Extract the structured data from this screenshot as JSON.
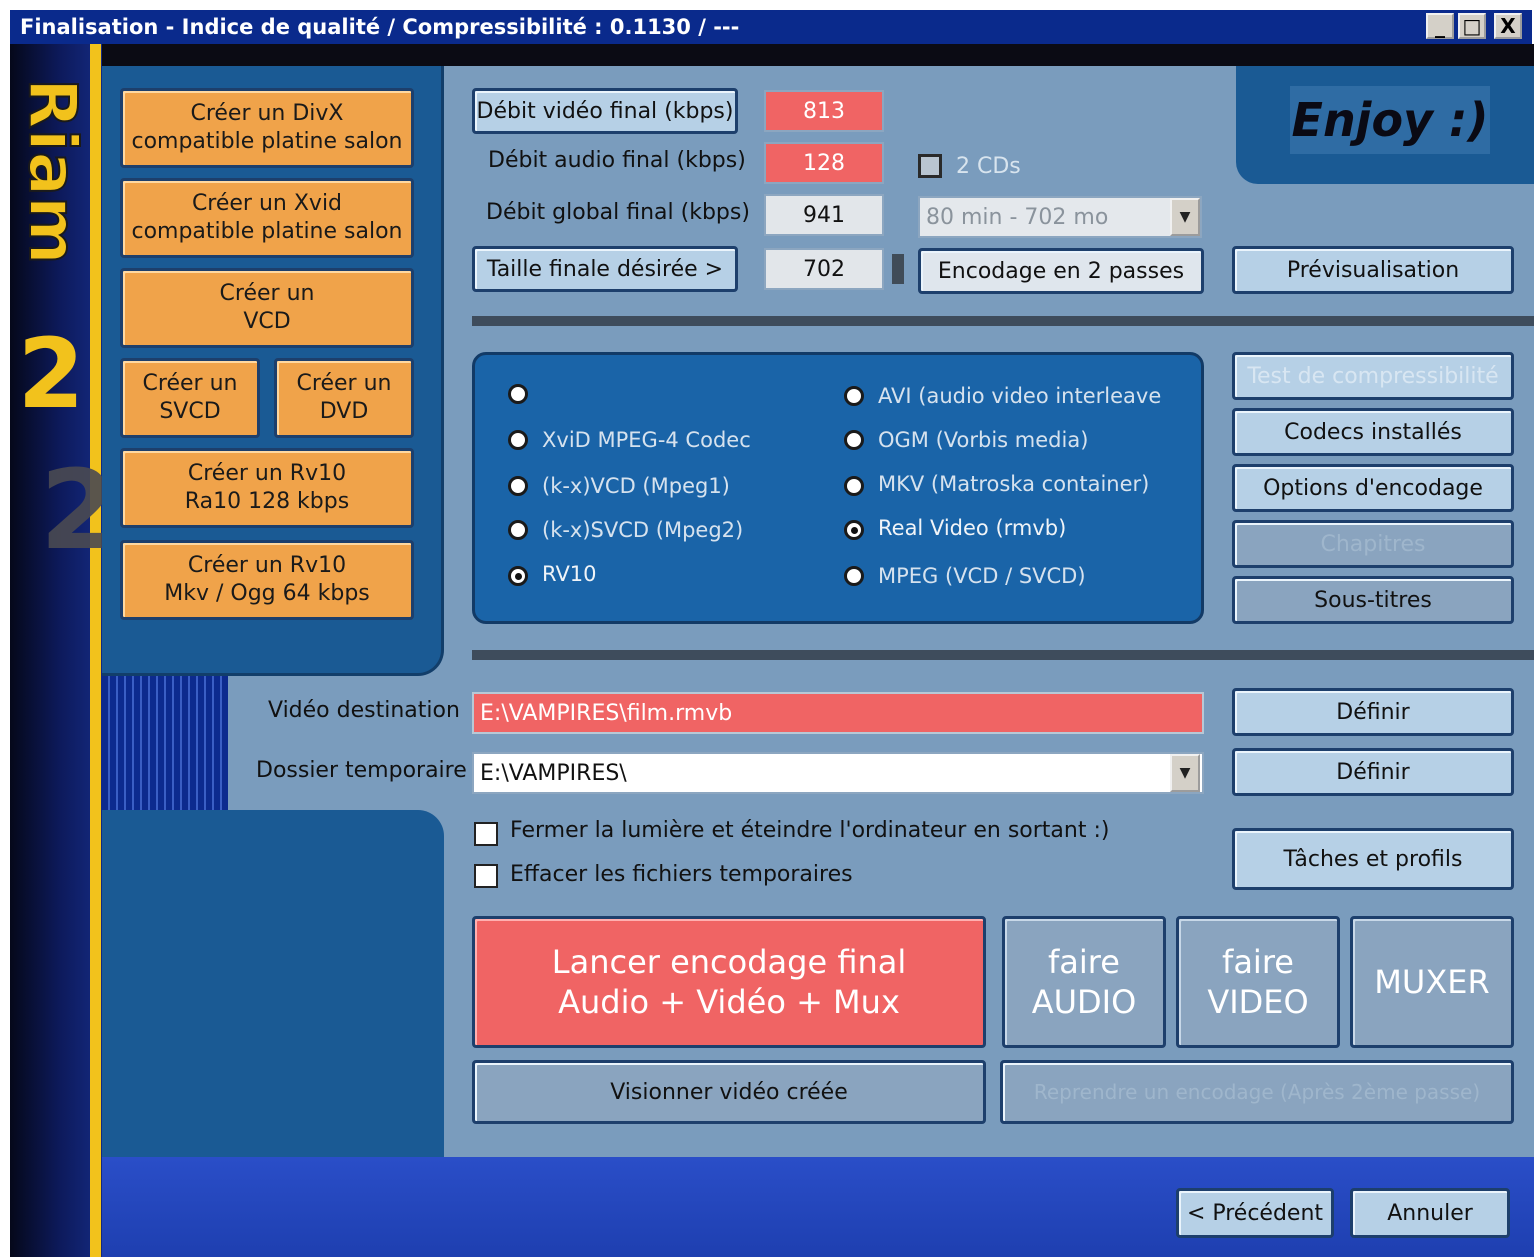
{
  "window": {
    "title": "Finalisation - Indice de qualité / Compressibilité : 0.1130 / ---",
    "min_label": "_",
    "max_label": "□",
    "close_label": "X"
  },
  "logo": {
    "brand": "Riam",
    "version": "2"
  },
  "presets": [
    {
      "label": "Créer un DivX\ncompatible platine salon"
    },
    {
      "label": "Créer un Xvid\ncompatible platine salon"
    },
    {
      "label": "Créer un\nVCD"
    },
    {
      "label": "Créer un\nSVCD"
    },
    {
      "label": "Créer un\nDVD"
    },
    {
      "label": "Créer un Rv10\nRa10 128 kbps"
    },
    {
      "label": "Créer un Rv10\nMkv / Ogg 64 kbps"
    }
  ],
  "bitrates": {
    "video_label": "Débit vidéo final (kbps)",
    "video_value": "813",
    "audio_label": "Débit audio final (kbps)",
    "audio_value": "128",
    "global_label": "Débit global final (kbps)",
    "global_value": "941",
    "size_label": "Taille finale désirée >",
    "size_value": "702"
  },
  "cd": {
    "checkbox_label": "2 CDs",
    "select_value": "80 min - 702 mo"
  },
  "two_pass_label": "Encodage en 2 passes",
  "enjoy_label": "Enjoy :)",
  "preview_label": "Prévisualisation",
  "codecs_left": [
    {
      "label": "",
      "selected": false
    },
    {
      "label": "XviD MPEG-4 Codec",
      "selected": false
    },
    {
      "label": "(k-x)VCD (Mpeg1)",
      "selected": false
    },
    {
      "label": "(k-x)SVCD (Mpeg2)",
      "selected": false
    },
    {
      "label": "RV10",
      "selected": true
    }
  ],
  "containers_right": [
    {
      "label": "AVI (audio video interleave",
      "selected": false
    },
    {
      "label": "OGM (Vorbis media)",
      "selected": false
    },
    {
      "label": "MKV (Matroska container)",
      "selected": false
    },
    {
      "label": "Real Video (rmvb)",
      "selected": true
    },
    {
      "label": "MPEG (VCD / SVCD)",
      "selected": false
    }
  ],
  "side_buttons": {
    "compress_test": "Test de compressibilité",
    "codecs_installed": "Codecs installés",
    "encoding_options": "Options d'encodage",
    "chapters": "Chapitres",
    "subtitles": "Sous-titres"
  },
  "destination": {
    "video_label": "Vidéo destination",
    "video_value": "E:\\VAMPIRES\\film.rmvb",
    "temp_label": "Dossier temporaire",
    "temp_value": "E:\\VAMPIRES\\",
    "define_label": "Définir"
  },
  "options": {
    "shutdown_label": "Fermer la lumière et éteindre l'ordinateur en sortant :)",
    "delete_temp_label": "Effacer les fichiers temporaires"
  },
  "tasks_label": "Tâches et profils",
  "actions": {
    "launch": "Lancer encodage final\nAudio + Vidéo + Mux",
    "audio": "faire\nAUDIO",
    "video": "faire\nVIDEO",
    "mux": "MUXER",
    "view": "Visionner vidéo créée",
    "resume": "Reprendre un encodage (Après 2ème passe)"
  },
  "nav": {
    "previous": "< Précédent",
    "cancel": "Annuler"
  },
  "colors": {
    "accent_red": "#f06464",
    "orange": "#f0a34a",
    "panel_blue": "#1a64a8",
    "title_blue": "#0a2a8c",
    "logo_yellow": "#f2c21c"
  }
}
